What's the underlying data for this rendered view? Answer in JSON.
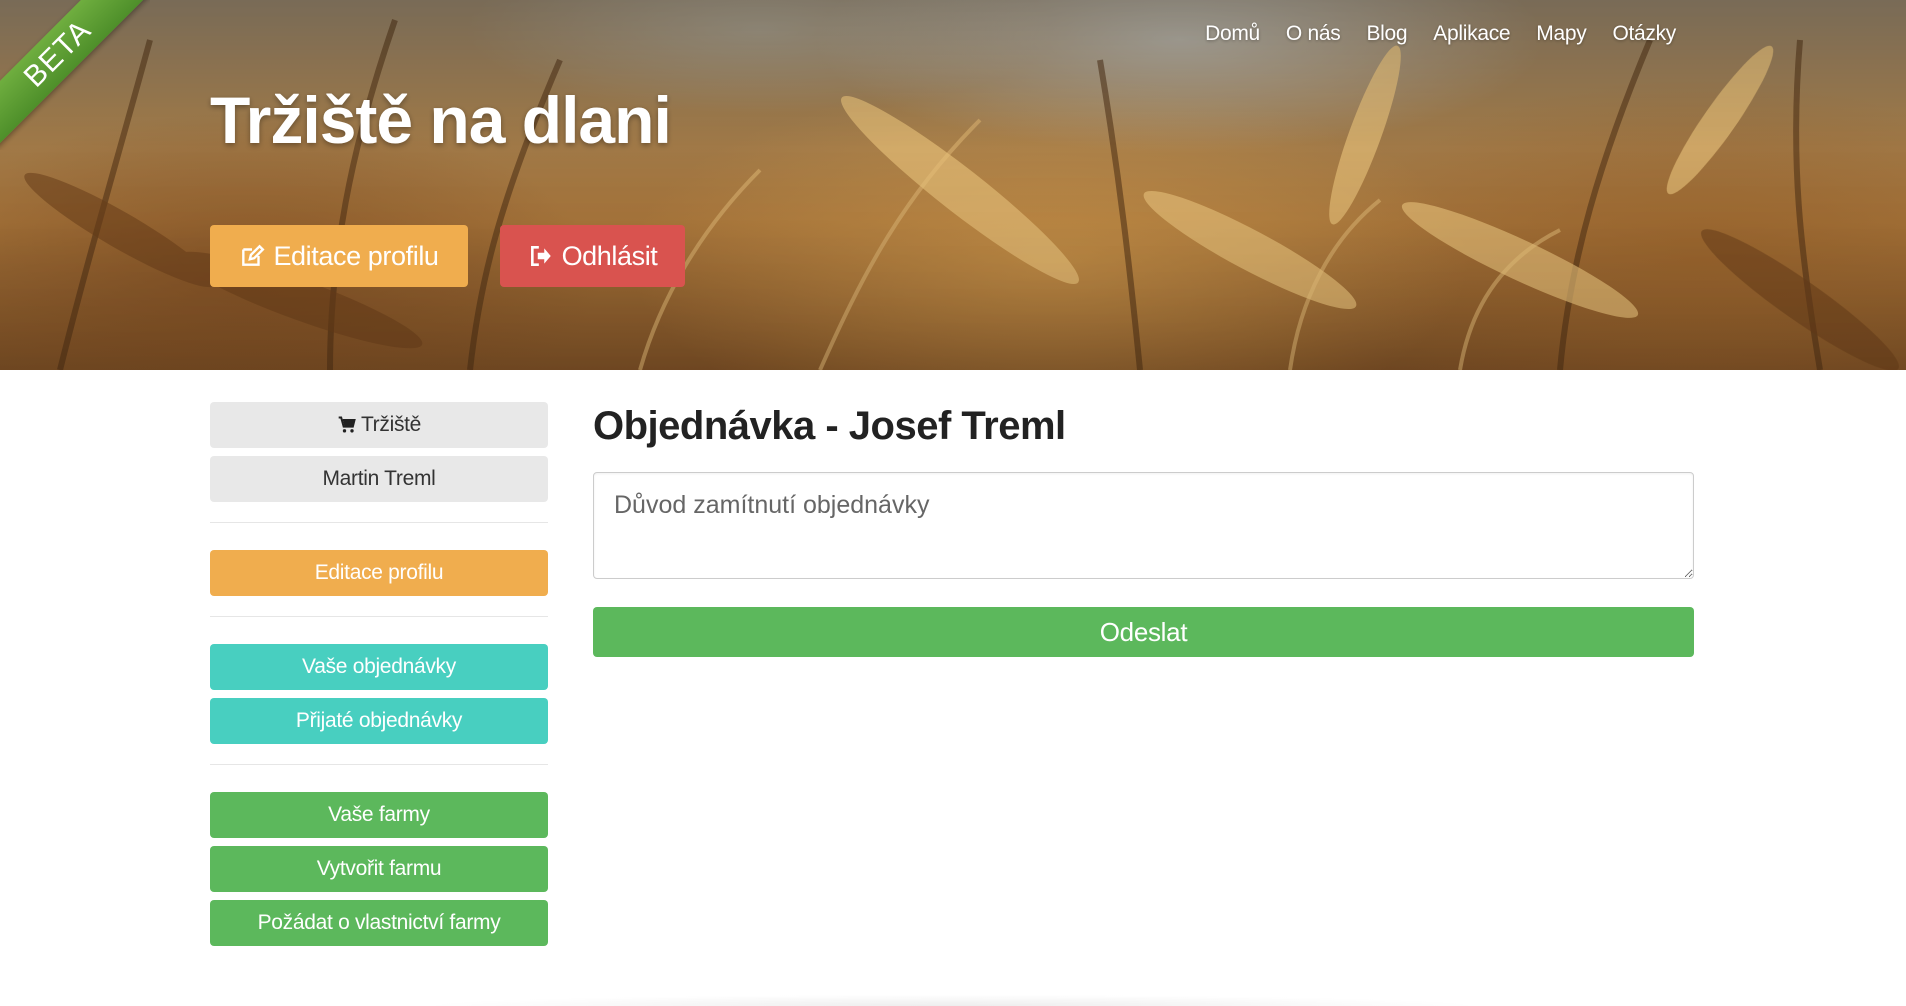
{
  "badge": {
    "label": "BETA"
  },
  "nav": {
    "items": [
      {
        "label": "Domů"
      },
      {
        "label": "O nás"
      },
      {
        "label": "Blog"
      },
      {
        "label": "Aplikace"
      },
      {
        "label": "Mapy"
      },
      {
        "label": "Otázky"
      }
    ]
  },
  "header": {
    "title": "Tržiště na dlani",
    "edit_profile_label": "Editace profilu",
    "logout_label": "Odhlásit"
  },
  "sidebar": {
    "market_label": "Tržiště",
    "user_name": "Martin Treml",
    "edit_profile_label": "Editace profilu",
    "your_orders_label": "Vaše objednávky",
    "received_orders_label": "Přijaté objednávky",
    "your_farms_label": "Vaše farmy",
    "create_farm_label": "Vytvořit farmu",
    "request_ownership_label": "Požádat o vlastnictví farmy"
  },
  "main": {
    "title": "Objednávka - Josef Treml",
    "reason_placeholder": "Důvod zamítnutí objednávky",
    "reason_value": "",
    "submit_label": "Odeslat"
  },
  "colors": {
    "warning": "#f0ad4e",
    "danger": "#d9534f",
    "teal": "#48cfc0",
    "success": "#5cb85c",
    "ribbon": "#5a9c33"
  }
}
